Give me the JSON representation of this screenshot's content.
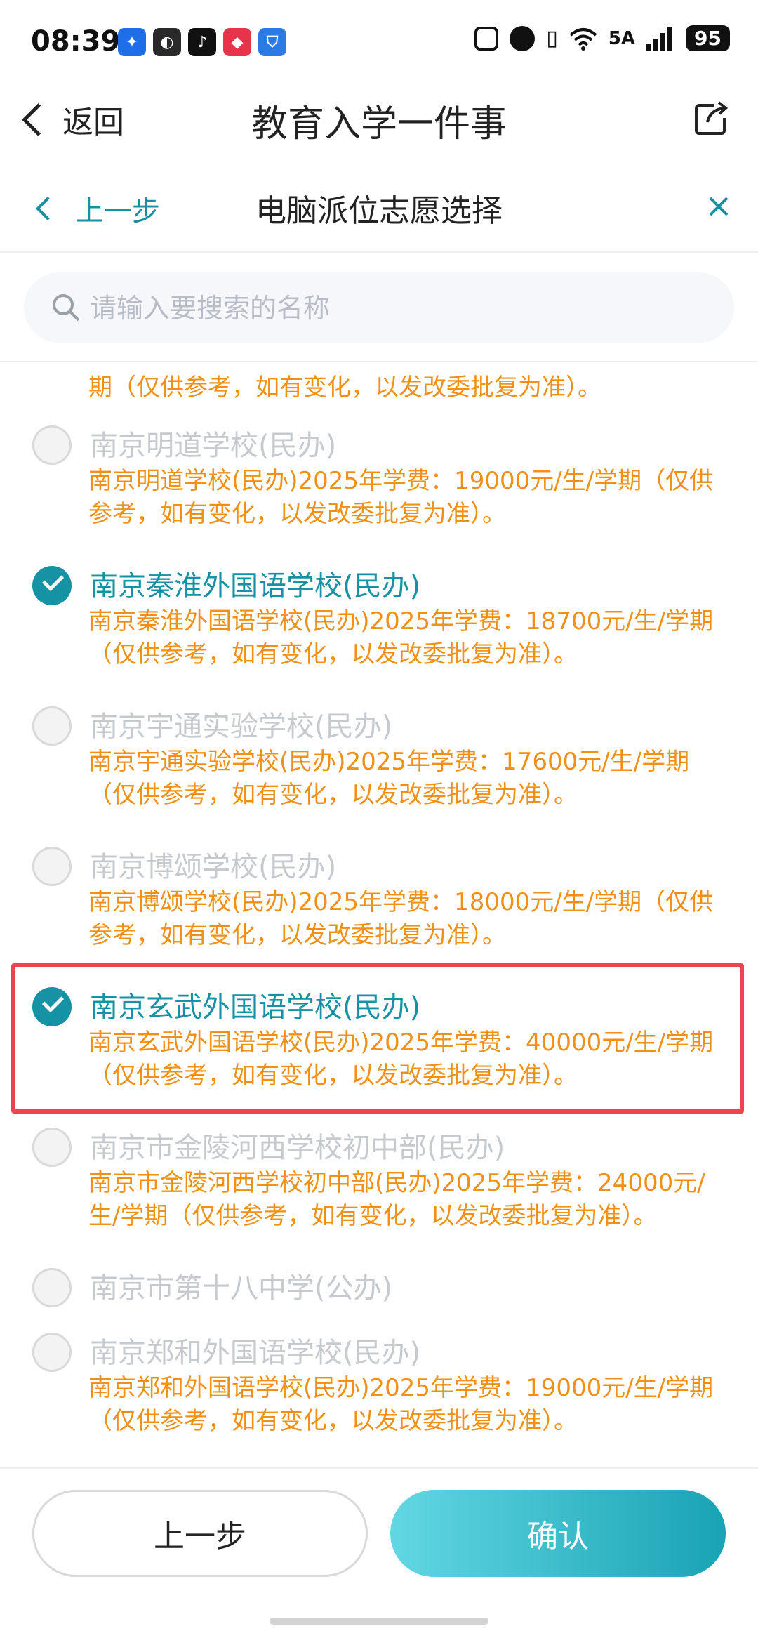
{
  "status_bar": {
    "time": "08:39",
    "network": "5A",
    "battery": "95",
    "app_icons": [
      {
        "icon": "bulb-icon",
        "color": "#1e6ee8"
      },
      {
        "icon": "browser-icon",
        "color": "#2a2a2a"
      },
      {
        "icon": "tiktok-icon",
        "color": "#111111"
      },
      {
        "icon": "xiaohongshu-icon",
        "color": "#e8344a"
      },
      {
        "icon": "shield-icon",
        "color": "#2c7be5"
      }
    ]
  },
  "nav": {
    "back_label": "返回",
    "title": "教育入学一件事"
  },
  "sub_header": {
    "back_label": "上一步",
    "title": "电脑派位志愿选择"
  },
  "search": {
    "placeholder": "请输入要搜索的名称"
  },
  "list": {
    "partial_desc": "期（仅供参考，如有变化，以发改委批复为准）。",
    "items": [
      {
        "name": "南京明道学校(民办)",
        "selected": false,
        "desc_line1": "南京明道学校(民办)2025年学费：19000元/生/学期（仅供",
        "desc_line2": "参考，如有变化，以发改委批复为准）。"
      },
      {
        "name": "南京秦淮外国语学校(民办)",
        "selected": true,
        "desc_line1": "南京秦淮外国语学校(民办)2025年学费：18700元/生/学期",
        "desc_line2": "（仅供参考，如有变化，以发改委批复为准）。"
      },
      {
        "name": "南京宇通实验学校(民办)",
        "selected": false,
        "desc_line1": "南京宇通实验学校(民办)2025年学费：17600元/生/学期",
        "desc_line2": "（仅供参考，如有变化，以发改委批复为准）。"
      },
      {
        "name": "南京博颂学校(民办)",
        "selected": false,
        "desc_line1": "南京博颂学校(民办)2025年学费：18000元/生/学期（仅供",
        "desc_line2": "参考，如有变化，以发改委批复为准）。"
      },
      {
        "name": "南京玄武外国语学校(民办)",
        "selected": true,
        "desc_line1": "南京玄武外国语学校(民办)2025年学费：40000元/生/学期",
        "desc_line2": "（仅供参考，如有变化，以发改委批复为准）。"
      },
      {
        "name": "南京市金陵河西学校初中部(民办)",
        "selected": false,
        "desc_line1": "南京市金陵河西学校初中部(民办)2025年学费：24000元/",
        "desc_line2": "生/学期（仅供参考，如有变化，以发改委批复为准）。"
      },
      {
        "name": "南京市第十八中学(公办)",
        "selected": false
      },
      {
        "name": "南京郑和外国语学校(民办)",
        "selected": false,
        "desc_line1": "南京郑和外国语学校(民办)2025年学费：19000元/生/学期",
        "desc_line2": "（仅供参考，如有变化，以发改委批复为准）。"
      }
    ]
  },
  "footer": {
    "prev_label": "上一步",
    "confirm_label": "确认"
  },
  "colors": {
    "accent": "#1592a3",
    "desc": "#f09017",
    "highlight": "#ee4250"
  }
}
